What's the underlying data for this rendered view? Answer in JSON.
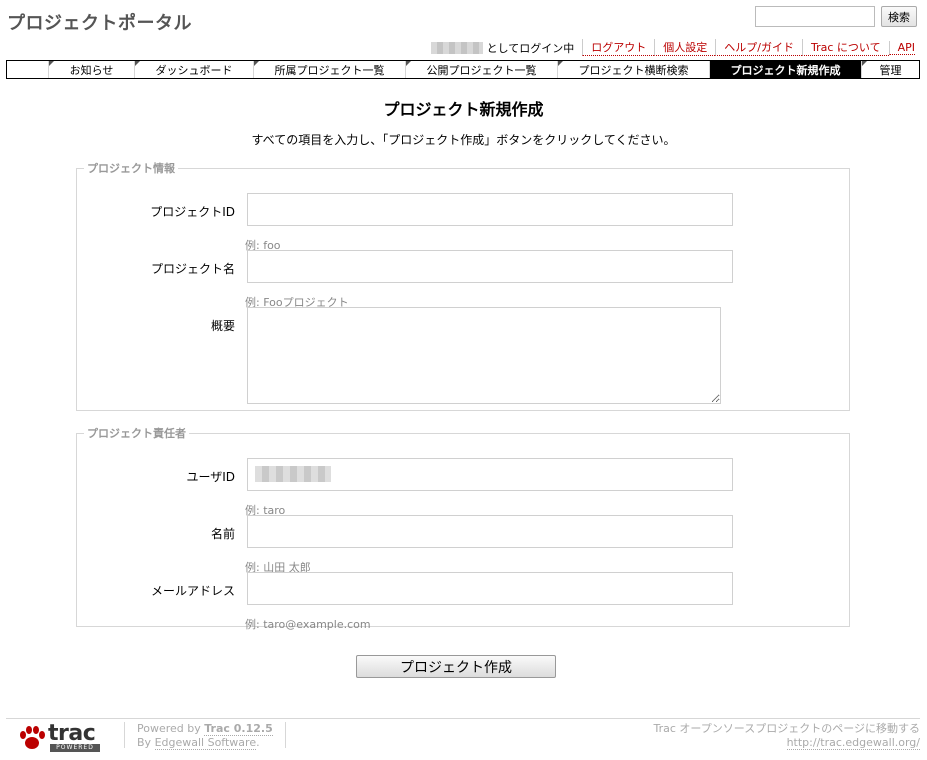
{
  "header": {
    "title": "プロジェクトポータル"
  },
  "search": {
    "placeholder": "",
    "button_label": "検索"
  },
  "metanav": {
    "login_text": "としてログイン中",
    "links": [
      "ログアウト",
      "個人設定",
      "ヘルプ/ガイド",
      "Trac について",
      "API"
    ]
  },
  "mainnav": {
    "tabs": [
      "お知らせ",
      "ダッシュボード",
      "所属プロジェクト一覧",
      "公開プロジェクト一覧",
      "プロジェクト横断検索",
      "プロジェクト新規作成",
      "管理"
    ],
    "active": "プロジェクト新規作成"
  },
  "page": {
    "title": "プロジェクト新規作成",
    "intro": "すべての項目を入力し、「プロジェクト作成」ボタンをクリックしてください。"
  },
  "project_info": {
    "legend": "プロジェクト情報",
    "id_label": "プロジェクトID",
    "id_hint": "例: foo",
    "name_label": "プロジェクト名",
    "name_hint": "例: Fooプロジェクト",
    "desc_label": "概要"
  },
  "owner": {
    "legend": "プロジェクト責任者",
    "userid_label": "ユーザID",
    "userid_hint": "例: taro",
    "name_label": "名前",
    "name_hint": "例: 山田 太郎",
    "email_label": "メールアドレス",
    "email_hint": "例: taro@example.com"
  },
  "submit_label": "プロジェクト作成",
  "footer": {
    "logo_word": "trac",
    "logo_badge": "POWERED",
    "powered_by": "Powered by",
    "trac_version": "Trac 0.12.5",
    "by": "By",
    "edgewall": "Edgewall Software",
    "right_text": "Trac オープンソースプロジェクトのページに移動する",
    "right_url": "http://trac.edgewall.org/"
  },
  "colors": {
    "link": "#bb0000",
    "active_tab_bg": "#000000",
    "hint": "#888888"
  }
}
